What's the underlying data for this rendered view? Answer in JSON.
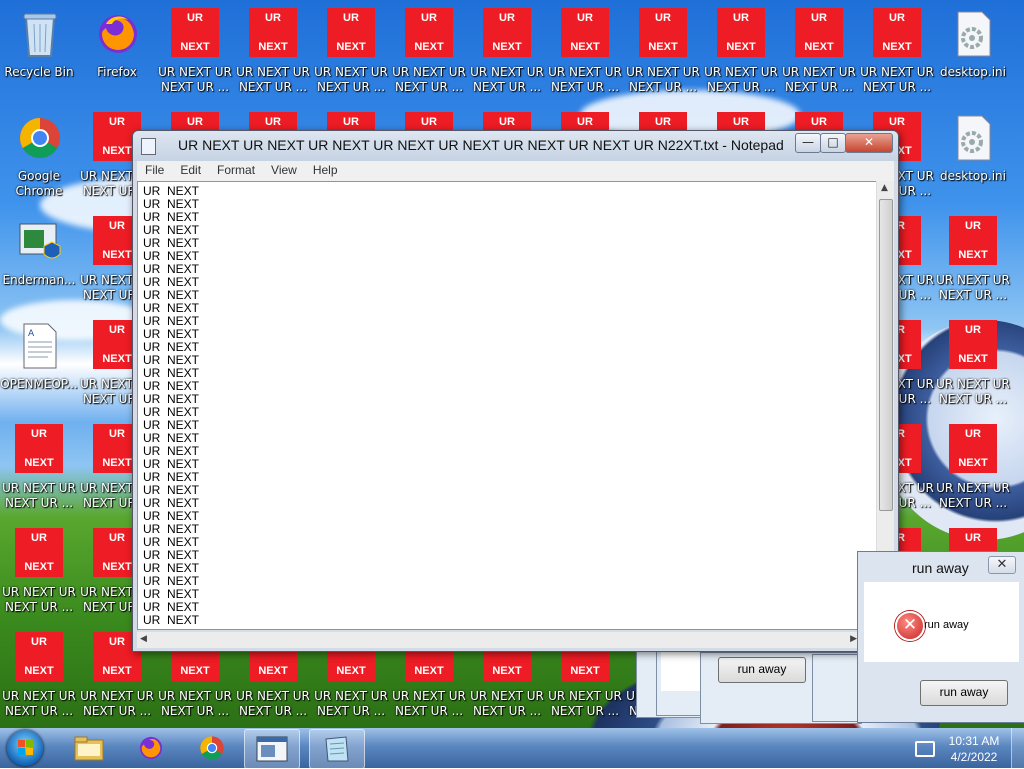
{
  "desktop": {
    "icons": {
      "recycle_bin": "Recycle Bin",
      "firefox": "Firefox",
      "chrome_line1": "Google",
      "chrome_line2": "Chrome",
      "enderman": "Enderman...",
      "openmeop": "OPENMEOP...",
      "desktop_ini": "desktop.ini",
      "red_line1": "UR NEXT UR",
      "red_line2": "NEXT UR ...",
      "red_top": "UR",
      "red_bottom": "NEXT"
    }
  },
  "notepad": {
    "title": "UR NEXT UR NEXT UR NEXT UR NEXT UR NEXT UR NEXT UR NEXT UR N22XT.txt - Notepad",
    "menu": [
      "File",
      "Edit",
      "Format",
      "View",
      "Help"
    ],
    "line_text": "UR  NEXT",
    "visible_line_count": 34
  },
  "dialog": {
    "title": "run away",
    "message": "run away",
    "button": "run away",
    "back_button": "run away"
  },
  "taskbar": {
    "time": "10:31 AM",
    "date": "4/2/2022"
  },
  "colors": {
    "red_icon": "#ee1c24",
    "taskbar": "#3a649d"
  }
}
